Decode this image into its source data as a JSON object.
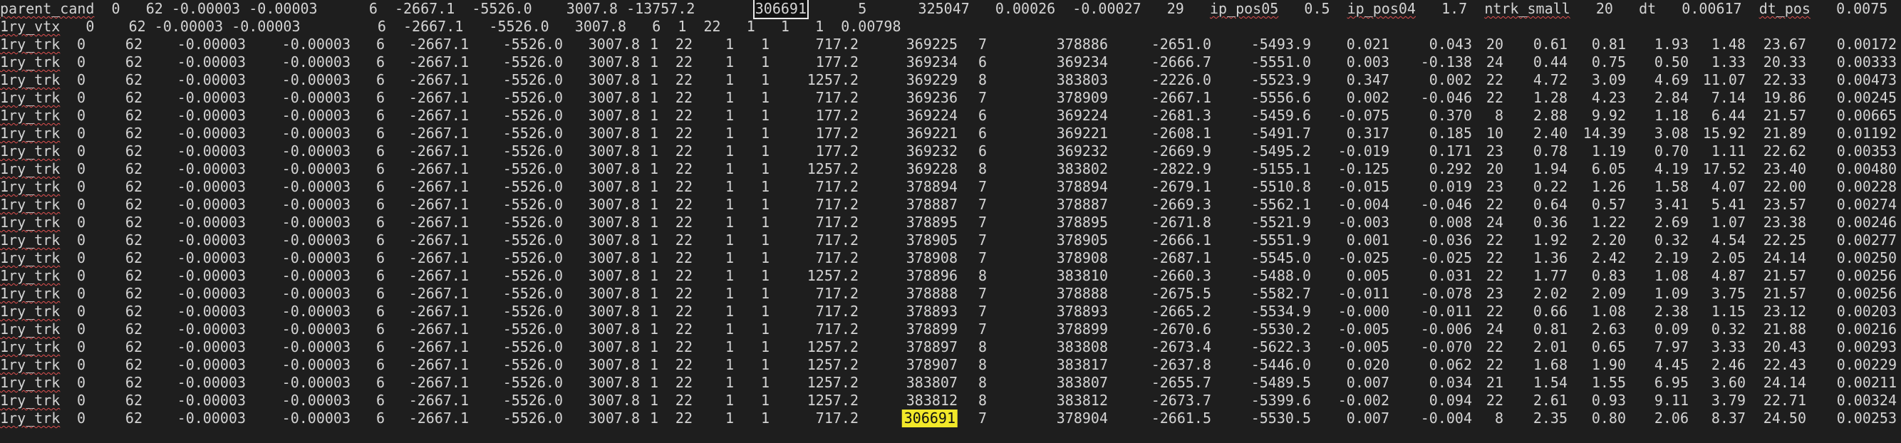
{
  "terminal": {
    "header": "parent_cand  0   62 -0.00003 -0.00003      6  -2667.1  -5526.0    3007.8 -13757.2       306691      5      325047   0.00026  -0.00027   29   ip_pos05   0.5  ip_pos04   1.7  ntrk_small   20   dt   0.00617  dt_pos   0.0075",
    "header_boxed_value": "306691",
    "vtx_row": "1ry_vtx   0    62 -0.00003 -0.00003         6  -2667.1   -5526.0   3007.8   6  1  22   1   1   1  0.00798",
    "rows": [
      [
        "1ry_trk",
        "0",
        "62",
        "-0.00003",
        "-0.00003",
        "6",
        "-2667.1",
        "-5526.0",
        "3007.8",
        "1",
        "22",
        "1",
        "1",
        "717.2",
        "369225",
        "7",
        "378886",
        "-2651.0",
        "-5493.9",
        "0.021",
        "0.043",
        "20",
        "0.61",
        "0.81",
        "1.93",
        "1.48",
        "23.67",
        "0.00172"
      ],
      [
        "1ry_trk",
        "0",
        "62",
        "-0.00003",
        "-0.00003",
        "6",
        "-2667.1",
        "-5526.0",
        "3007.8",
        "1",
        "22",
        "1",
        "1",
        "177.2",
        "369234",
        "6",
        "369234",
        "-2666.7",
        "-5551.0",
        "0.003",
        "-0.138",
        "24",
        "0.44",
        "0.75",
        "0.50",
        "1.33",
        "20.33",
        "0.00333"
      ],
      [
        "1ry_trk",
        "0",
        "62",
        "-0.00003",
        "-0.00003",
        "6",
        "-2667.1",
        "-5526.0",
        "3007.8",
        "1",
        "22",
        "1",
        "1",
        "1257.2",
        "369229",
        "8",
        "383803",
        "-2226.0",
        "-5523.9",
        "0.347",
        "0.002",
        "22",
        "4.72",
        "3.09",
        "4.69",
        "11.07",
        "22.33",
        "0.00473"
      ],
      [
        "1ry_trk",
        "0",
        "62",
        "-0.00003",
        "-0.00003",
        "6",
        "-2667.1",
        "-5526.0",
        "3007.8",
        "1",
        "22",
        "1",
        "1",
        "717.2",
        "369236",
        "7",
        "378909",
        "-2667.1",
        "-5556.6",
        "0.002",
        "-0.046",
        "22",
        "1.28",
        "4.23",
        "2.84",
        "7.14",
        "19.86",
        "0.00245"
      ],
      [
        "1ry_trk",
        "0",
        "62",
        "-0.00003",
        "-0.00003",
        "6",
        "-2667.1",
        "-5526.0",
        "3007.8",
        "1",
        "22",
        "1",
        "1",
        "177.2",
        "369224",
        "6",
        "369224",
        "-2681.3",
        "-5459.6",
        "-0.075",
        "0.370",
        "8",
        "2.88",
        "9.92",
        "1.18",
        "6.44",
        "21.57",
        "0.00665"
      ],
      [
        "1ry_trk",
        "0",
        "62",
        "-0.00003",
        "-0.00003",
        "6",
        "-2667.1",
        "-5526.0",
        "3007.8",
        "1",
        "22",
        "1",
        "1",
        "177.2",
        "369221",
        "6",
        "369221",
        "-2608.1",
        "-5491.7",
        "0.317",
        "0.185",
        "10",
        "2.40",
        "14.39",
        "3.08",
        "15.92",
        "21.89",
        "0.01192"
      ],
      [
        "1ry_trk",
        "0",
        "62",
        "-0.00003",
        "-0.00003",
        "6",
        "-2667.1",
        "-5526.0",
        "3007.8",
        "1",
        "22",
        "1",
        "1",
        "177.2",
        "369232",
        "6",
        "369232",
        "-2669.9",
        "-5495.2",
        "-0.019",
        "0.171",
        "23",
        "0.78",
        "1.19",
        "0.70",
        "1.11",
        "22.62",
        "0.00353"
      ],
      [
        "1ry_trk",
        "0",
        "62",
        "-0.00003",
        "-0.00003",
        "6",
        "-2667.1",
        "-5526.0",
        "3007.8",
        "1",
        "22",
        "1",
        "1",
        "1257.2",
        "369228",
        "8",
        "383802",
        "-2822.9",
        "-5155.1",
        "-0.125",
        "0.292",
        "20",
        "1.94",
        "6.05",
        "4.19",
        "17.52",
        "23.40",
        "0.00480"
      ],
      [
        "1ry_trk",
        "0",
        "62",
        "-0.00003",
        "-0.00003",
        "6",
        "-2667.1",
        "-5526.0",
        "3007.8",
        "1",
        "22",
        "1",
        "1",
        "717.2",
        "378894",
        "7",
        "378894",
        "-2679.1",
        "-5510.8",
        "-0.015",
        "0.019",
        "23",
        "0.22",
        "1.26",
        "1.58",
        "4.07",
        "22.00",
        "0.00228"
      ],
      [
        "1ry_trk",
        "0",
        "62",
        "-0.00003",
        "-0.00003",
        "6",
        "-2667.1",
        "-5526.0",
        "3007.8",
        "1",
        "22",
        "1",
        "1",
        "717.2",
        "378887",
        "7",
        "378887",
        "-2669.3",
        "-5562.1",
        "-0.004",
        "-0.046",
        "22",
        "0.64",
        "0.57",
        "3.41",
        "5.41",
        "23.57",
        "0.00274"
      ],
      [
        "1ry_trk",
        "0",
        "62",
        "-0.00003",
        "-0.00003",
        "6",
        "-2667.1",
        "-5526.0",
        "3007.8",
        "1",
        "22",
        "1",
        "1",
        "717.2",
        "378895",
        "7",
        "378895",
        "-2671.8",
        "-5521.9",
        "-0.003",
        "0.008",
        "24",
        "0.36",
        "1.22",
        "2.69",
        "1.07",
        "23.38",
        "0.00246"
      ],
      [
        "1ry_trk",
        "0",
        "62",
        "-0.00003",
        "-0.00003",
        "6",
        "-2667.1",
        "-5526.0",
        "3007.8",
        "1",
        "22",
        "1",
        "1",
        "717.2",
        "378905",
        "7",
        "378905",
        "-2666.1",
        "-5551.9",
        "0.001",
        "-0.036",
        "22",
        "1.92",
        "2.20",
        "0.32",
        "4.54",
        "22.25",
        "0.00277"
      ],
      [
        "1ry_trk",
        "0",
        "62",
        "-0.00003",
        "-0.00003",
        "6",
        "-2667.1",
        "-5526.0",
        "3007.8",
        "1",
        "22",
        "1",
        "1",
        "717.2",
        "378908",
        "7",
        "378908",
        "-2687.1",
        "-5545.0",
        "-0.025",
        "-0.025",
        "22",
        "1.36",
        "2.42",
        "2.19",
        "2.05",
        "24.14",
        "0.00250"
      ],
      [
        "1ry_trk",
        "0",
        "62",
        "-0.00003",
        "-0.00003",
        "6",
        "-2667.1",
        "-5526.0",
        "3007.8",
        "1",
        "22",
        "1",
        "1",
        "1257.2",
        "378896",
        "8",
        "383810",
        "-2660.3",
        "-5488.0",
        "0.005",
        "0.031",
        "22",
        "1.77",
        "0.83",
        "1.08",
        "4.87",
        "21.57",
        "0.00256"
      ],
      [
        "1ry_trk",
        "0",
        "62",
        "-0.00003",
        "-0.00003",
        "6",
        "-2667.1",
        "-5526.0",
        "3007.8",
        "1",
        "22",
        "1",
        "1",
        "717.2",
        "378888",
        "7",
        "378888",
        "-2675.5",
        "-5582.7",
        "-0.011",
        "-0.078",
        "23",
        "2.02",
        "2.09",
        "1.09",
        "3.75",
        "21.57",
        "0.00256"
      ],
      [
        "1ry_trk",
        "0",
        "62",
        "-0.00003",
        "-0.00003",
        "6",
        "-2667.1",
        "-5526.0",
        "3007.8",
        "1",
        "22",
        "1",
        "1",
        "717.2",
        "378893",
        "7",
        "378893",
        "-2665.2",
        "-5534.9",
        "-0.000",
        "-0.011",
        "22",
        "0.66",
        "1.08",
        "2.38",
        "1.15",
        "23.12",
        "0.00203"
      ],
      [
        "1ry_trk",
        "0",
        "62",
        "-0.00003",
        "-0.00003",
        "6",
        "-2667.1",
        "-5526.0",
        "3007.8",
        "1",
        "22",
        "1",
        "1",
        "717.2",
        "378899",
        "7",
        "378899",
        "-2670.6",
        "-5530.2",
        "-0.005",
        "-0.006",
        "24",
        "0.81",
        "2.63",
        "0.09",
        "0.32",
        "21.88",
        "0.00216"
      ],
      [
        "1ry_trk",
        "0",
        "62",
        "-0.00003",
        "-0.00003",
        "6",
        "-2667.1",
        "-5526.0",
        "3007.8",
        "1",
        "22",
        "1",
        "1",
        "1257.2",
        "378897",
        "8",
        "383808",
        "-2673.4",
        "-5622.3",
        "-0.005",
        "-0.070",
        "22",
        "2.01",
        "0.65",
        "7.97",
        "3.33",
        "20.43",
        "0.00293"
      ],
      [
        "1ry_trk",
        "0",
        "62",
        "-0.00003",
        "-0.00003",
        "6",
        "-2667.1",
        "-5526.0",
        "3007.8",
        "1",
        "22",
        "1",
        "1",
        "1257.2",
        "378907",
        "8",
        "383817",
        "-2637.8",
        "-5446.0",
        "0.020",
        "0.062",
        "22",
        "1.68",
        "1.90",
        "4.45",
        "2.46",
        "22.43",
        "0.00229"
      ],
      [
        "1ry_trk",
        "0",
        "62",
        "-0.00003",
        "-0.00003",
        "6",
        "-2667.1",
        "-5526.0",
        "3007.8",
        "1",
        "22",
        "1",
        "1",
        "1257.2",
        "383807",
        "8",
        "383807",
        "-2655.7",
        "-5489.5",
        "0.007",
        "0.034",
        "21",
        "1.54",
        "1.55",
        "6.95",
        "3.60",
        "24.14",
        "0.00211"
      ],
      [
        "1ry_trk",
        "0",
        "62",
        "-0.00003",
        "-0.00003",
        "6",
        "-2667.1",
        "-5526.0",
        "3007.8",
        "1",
        "22",
        "1",
        "1",
        "1257.2",
        "383812",
        "8",
        "383812",
        "-2673.7",
        "-5399.6",
        "-0.002",
        "0.094",
        "22",
        "2.61",
        "0.93",
        "9.11",
        "3.79",
        "22.71",
        "0.00324"
      ],
      [
        "1ry_trk",
        "0",
        "62",
        "-0.00003",
        "-0.00003",
        "6",
        "-2667.1",
        "-5526.0",
        "3007.8",
        "1",
        "22",
        "1",
        "1",
        "717.2",
        "306691",
        "7",
        "378904",
        "-2661.5",
        "-5530.5",
        "0.007",
        "-0.004",
        "8",
        "2.35",
        "0.80",
        "2.06",
        "8.37",
        "24.50",
        "0.00253"
      ]
    ],
    "highlighted_value": "306691",
    "colors": {
      "background": "#1e1e1e",
      "text": "#d4d4d4",
      "highlight": "#f2e829",
      "spellcheck_underline": "#e05050"
    }
  }
}
